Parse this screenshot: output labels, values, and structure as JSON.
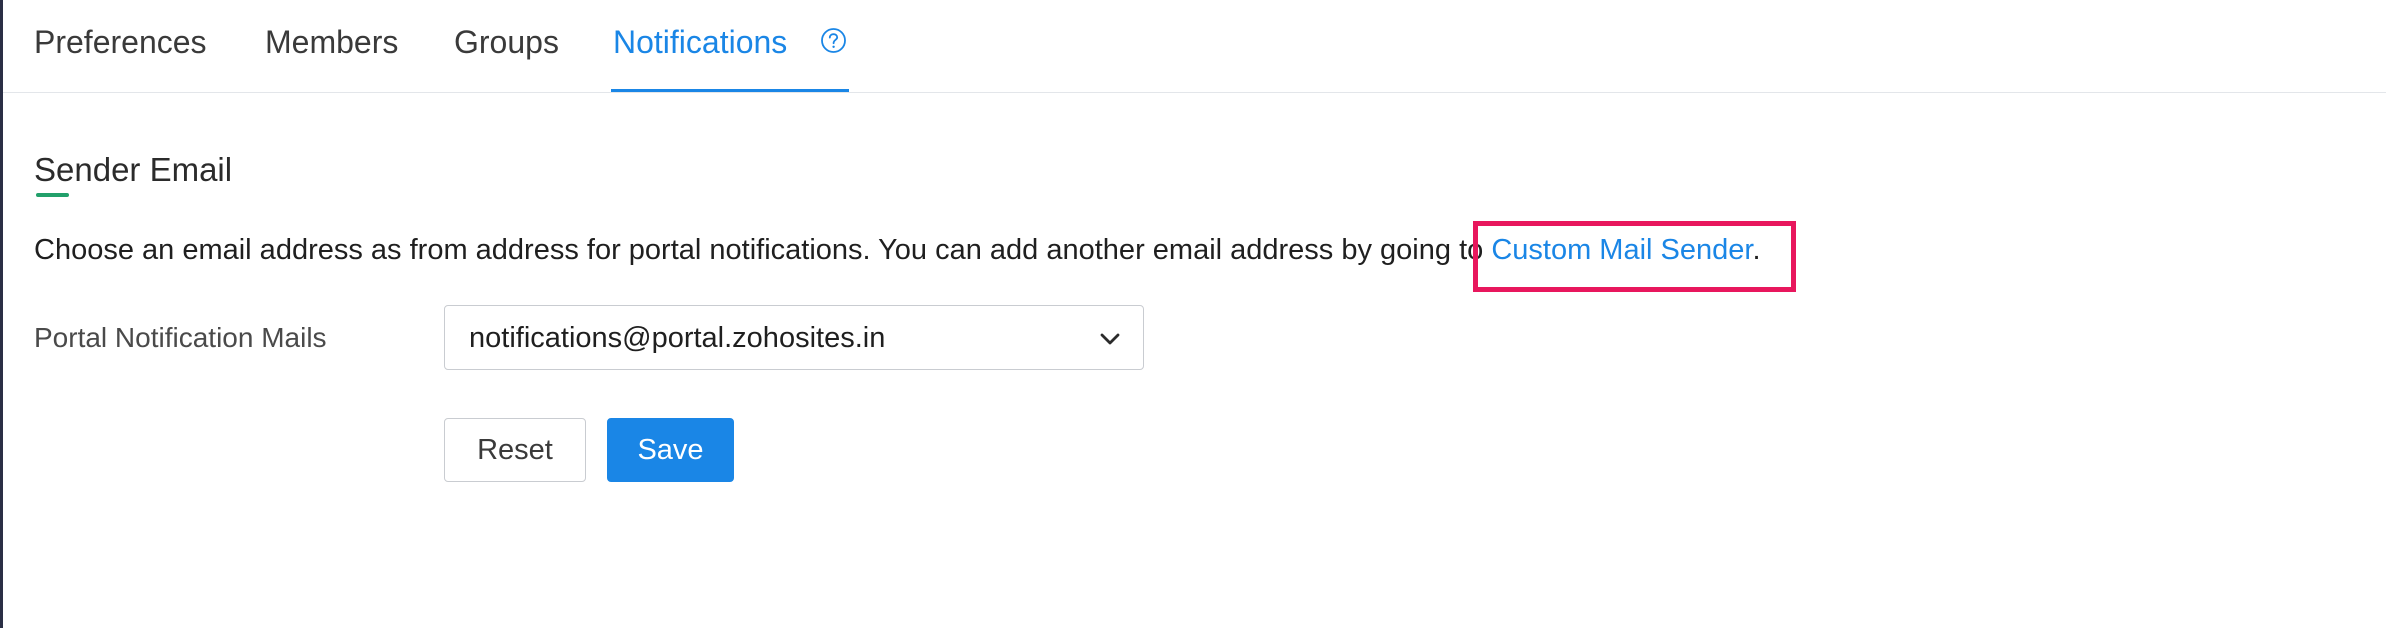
{
  "tabs": [
    {
      "label": "Preferences",
      "active": false
    },
    {
      "label": "Members",
      "active": false
    },
    {
      "label": "Groups",
      "active": false
    },
    {
      "label": "Notifications",
      "active": true
    }
  ],
  "help_icon": "question-circle-icon",
  "section": {
    "title": "Sender Email",
    "description_text": "Choose an email address as from address for portal notifications. You can add another email address by going to ",
    "description_link": "Custom Mail Sender",
    "description_suffix": "."
  },
  "field": {
    "label": "Portal Notification Mails",
    "selected_value": "notifications@portal.zohosites.in",
    "dropdown_icon": "chevron-down-icon"
  },
  "buttons": {
    "reset_label": "Reset",
    "save_label": "Save"
  },
  "colors": {
    "accent": "#1a86e6",
    "section_accent": "#22a06b",
    "highlight": "#e8175d"
  }
}
